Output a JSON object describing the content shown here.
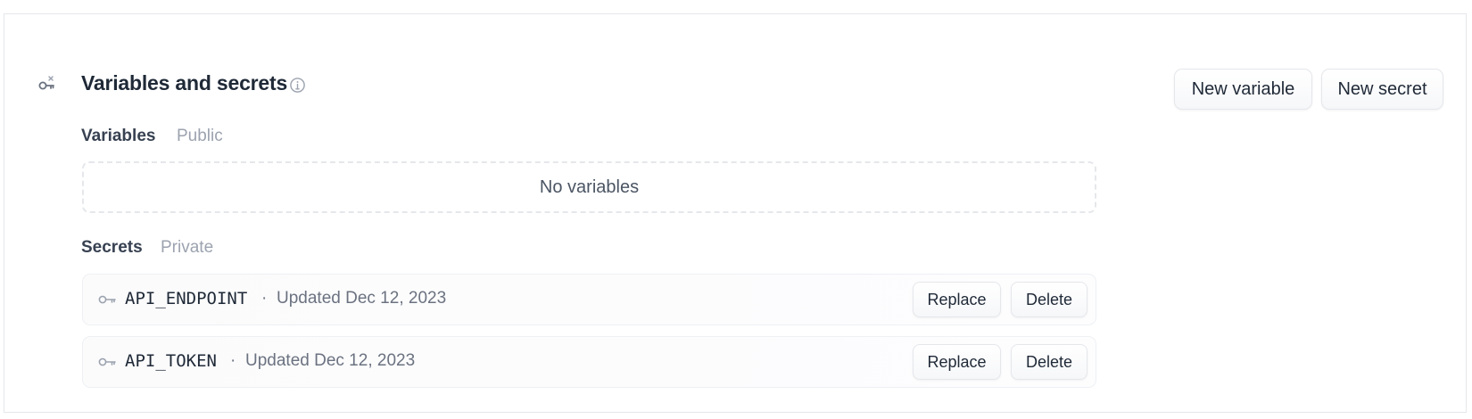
{
  "section": {
    "title": "Variables and secrets",
    "icon": "key-variable-icon",
    "info_icon": "info-icon"
  },
  "actions": {
    "new_variable_label": "New variable",
    "new_secret_label": "New secret"
  },
  "variables": {
    "heading": "Variables",
    "visibility": "Public",
    "empty_text": "No variables"
  },
  "secrets": {
    "heading": "Secrets",
    "visibility": "Private",
    "items": [
      {
        "name": "API_ENDPOINT",
        "separator": "·",
        "updated": "Updated Dec 12, 2023",
        "replace_label": "Replace",
        "delete_label": "Delete"
      },
      {
        "name": "API_TOKEN",
        "separator": "·",
        "updated": "Updated Dec 12, 2023",
        "replace_label": "Replace",
        "delete_label": "Delete"
      }
    ]
  },
  "colors": {
    "text_primary": "#1f2937",
    "text_muted": "#9ca3af",
    "border": "#e5e7eb"
  }
}
